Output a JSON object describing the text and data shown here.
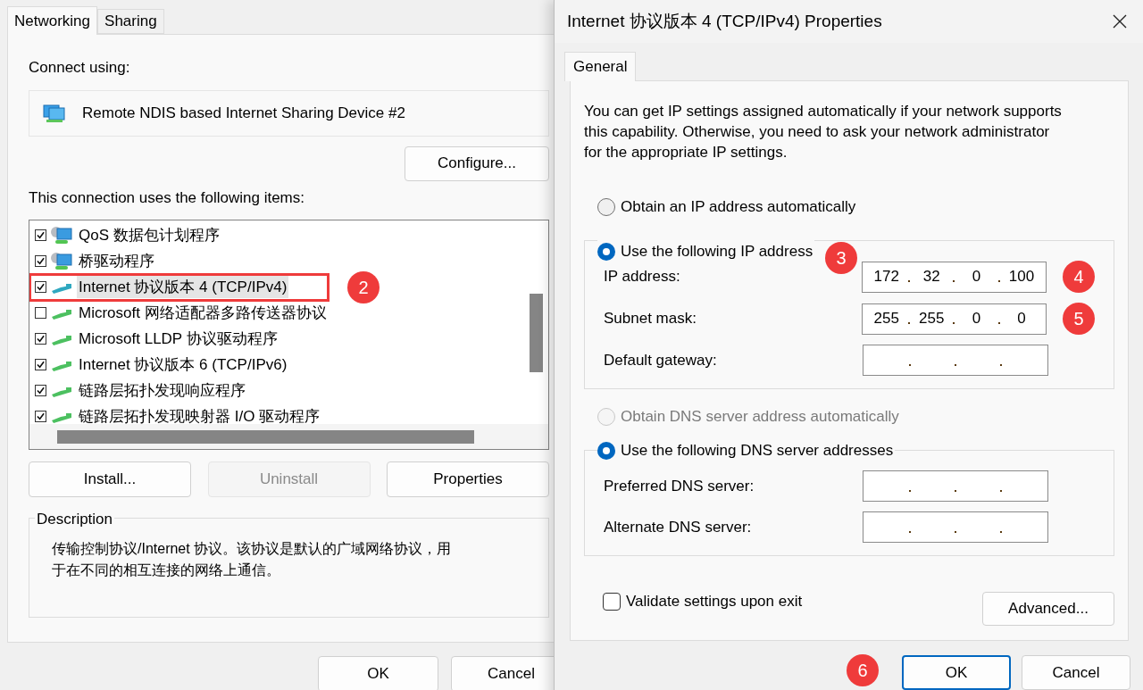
{
  "network_properties": {
    "tabs": [
      {
        "label": "Networking",
        "selected": true
      },
      {
        "label": "Sharing",
        "selected": false
      }
    ],
    "connect_using_label": "Connect using:",
    "adapter": "Remote NDIS based Internet Sharing Device #2",
    "configure_button": "Configure...",
    "items_label": "This connection uses the following items:",
    "items": [
      {
        "label": "QoS 数据包计划程序",
        "checked": true,
        "kind": "service",
        "selected": false,
        "highlighted": false
      },
      {
        "label": "桥驱动程序",
        "checked": true,
        "kind": "service",
        "selected": false,
        "highlighted": false
      },
      {
        "label": "Internet 协议版本 4 (TCP/IPv4)",
        "checked": true,
        "kind": "protocol",
        "selected": true,
        "highlighted": true,
        "callout": "2"
      },
      {
        "label": "Microsoft 网络适配器多路传送器协议",
        "checked": false,
        "kind": "protocol",
        "selected": false,
        "highlighted": false
      },
      {
        "label": "Microsoft LLDP 协议驱动程序",
        "checked": true,
        "kind": "protocol",
        "selected": false,
        "highlighted": false
      },
      {
        "label": "Internet 协议版本 6 (TCP/IPv6)",
        "checked": true,
        "kind": "protocol",
        "selected": false,
        "highlighted": false
      },
      {
        "label": "链路层拓扑发现响应程序",
        "checked": true,
        "kind": "protocol",
        "selected": false,
        "highlighted": false
      },
      {
        "label": "链路层拓扑发现映射器 I/O 驱动程序",
        "checked": true,
        "kind": "protocol",
        "selected": false,
        "highlighted": false
      }
    ],
    "buttons": [
      {
        "label": "Install...",
        "disabled": false
      },
      {
        "label": "Uninstall",
        "disabled": true
      },
      {
        "label": "Properties",
        "disabled": false
      }
    ],
    "description": {
      "legend": "Description",
      "text": "传输控制协议/Internet 协议。该协议是默认的广域网络协议，用于在不同的相互连接的网络上通信。"
    },
    "footer_buttons": [
      {
        "label": "OK",
        "default": false
      },
      {
        "label": "Cancel",
        "default": false
      }
    ]
  },
  "ipv4_dialog": {
    "title": "Internet 协议版本 4 (TCP/IPv4) Properties",
    "tabs": [
      {
        "label": "General",
        "selected": true
      }
    ],
    "intro": "You can get IP settings assigned automatically if your network supports this capability. Otherwise, you need to ask your network administrator for the appropriate IP settings.",
    "ip_section": {
      "auto_radio": {
        "label": "Obtain an IP address automatically",
        "selected": false,
        "disabled": false
      },
      "manual_radio": {
        "label": "Use the following IP address",
        "selected": true,
        "disabled": false,
        "callout": "3"
      },
      "fields": [
        {
          "label": "IP address:",
          "octets": [
            "172",
            "32",
            "0",
            "100"
          ],
          "callout": "4"
        },
        {
          "label": "Subnet mask:",
          "octets": [
            "255",
            "255",
            "0",
            "0"
          ],
          "callout": "5"
        },
        {
          "label": "Default gateway:"
        }
      ]
    },
    "dns_section": {
      "auto_radio": {
        "label": "Obtain DNS server address automatically",
        "selected": false,
        "disabled": true
      },
      "manual_radio": {
        "label": "Use the following DNS server addresses",
        "selected": true,
        "disabled": false
      },
      "fields": [
        {
          "label": "Preferred DNS server:"
        },
        {
          "label": "Alternate DNS server:"
        }
      ]
    },
    "validate_checkbox": {
      "label": "Validate settings upon exit",
      "checked": false
    },
    "advanced_button": "Advanced...",
    "footer_buttons": [
      {
        "label": "OK",
        "default": true,
        "callout": "6"
      },
      {
        "label": "Cancel",
        "default": false
      }
    ]
  }
}
